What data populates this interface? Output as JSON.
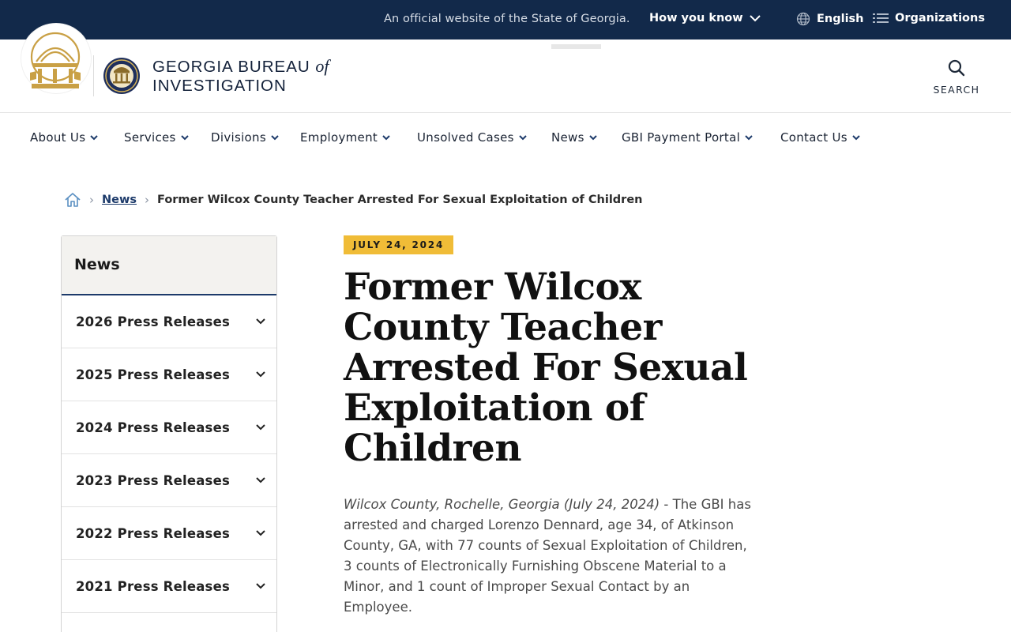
{
  "gov_banner": {
    "official_text": "An official website of the State of Georgia.",
    "how_you_know": "How you know",
    "language": "English",
    "organizations": "Organizations"
  },
  "header": {
    "agency_line1": "GEORGIA BUREAU",
    "agency_of": "of",
    "agency_line2": "INVESTIGATION",
    "search_label": "SEARCH"
  },
  "nav": {
    "items": [
      {
        "label": "About Us"
      },
      {
        "label": "Services"
      },
      {
        "label": "Divisions"
      },
      {
        "label": "Employment"
      },
      {
        "label": "Unsolved Cases"
      },
      {
        "label": "News"
      },
      {
        "label": "GBI Payment Portal"
      },
      {
        "label": "Contact Us"
      }
    ],
    "active": "News"
  },
  "breadcrumb": {
    "link": "News",
    "current": "Former Wilcox County Teacher Arrested For Sexual Exploitation of Children"
  },
  "sidebar": {
    "title": "News",
    "items": [
      {
        "label": "2026 Press Releases"
      },
      {
        "label": "2025 Press Releases"
      },
      {
        "label": "2024 Press Releases"
      },
      {
        "label": "2023 Press Releases"
      },
      {
        "label": "2022 Press Releases"
      },
      {
        "label": "2021 Press Releases"
      }
    ]
  },
  "article": {
    "date": "JULY 24, 2024",
    "title": "Former Wilcox County Teacher Arrested For Sexual Exploitation of Children",
    "dateline": "Wilcox County, Rochelle, Georgia (July 24, 2024)",
    "body": " - The GBI has arrested and charged Lorenzo Dennard, age 34, of Atkinson County, GA, with 77 counts of Sexual Exploitation of Children, 3 counts of Electronically Furnishing Obscene Material to a Minor, and 1 count of Improper Sexual Contact by an Employee."
  },
  "colors": {
    "navy": "#12294a",
    "gold": "#f0bc37",
    "link_blue": "#1c3a6a"
  }
}
